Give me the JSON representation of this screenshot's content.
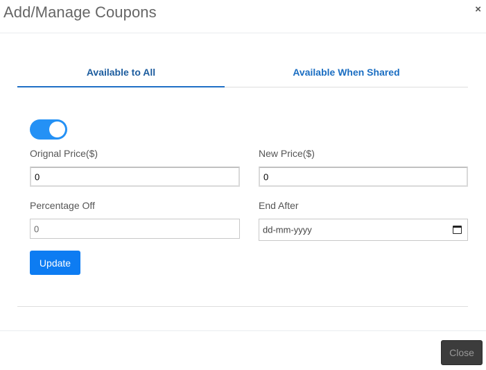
{
  "header": {
    "title": "Add/Manage Coupons",
    "close_icon": "×"
  },
  "tabs": [
    {
      "label": "Available to All",
      "active": true
    },
    {
      "label": "Available When Shared",
      "active": false
    }
  ],
  "form": {
    "toggle_on": true,
    "original_price": {
      "label": "Orignal Price($)",
      "value": "0"
    },
    "new_price": {
      "label": "New Price($)",
      "value": "0"
    },
    "percentage_off": {
      "label": "Percentage Off",
      "value": "0"
    },
    "end_after": {
      "label": "End After",
      "placeholder": "dd-mm-yyyy",
      "icon": "calendar-icon"
    },
    "update_label": "Update"
  },
  "footer": {
    "close_label": "Close"
  },
  "colors": {
    "accent": "#1b6ec2",
    "toggle": "#2491f5",
    "primary_button": "#0d7cf2",
    "close_button": "#3c3c3c"
  }
}
